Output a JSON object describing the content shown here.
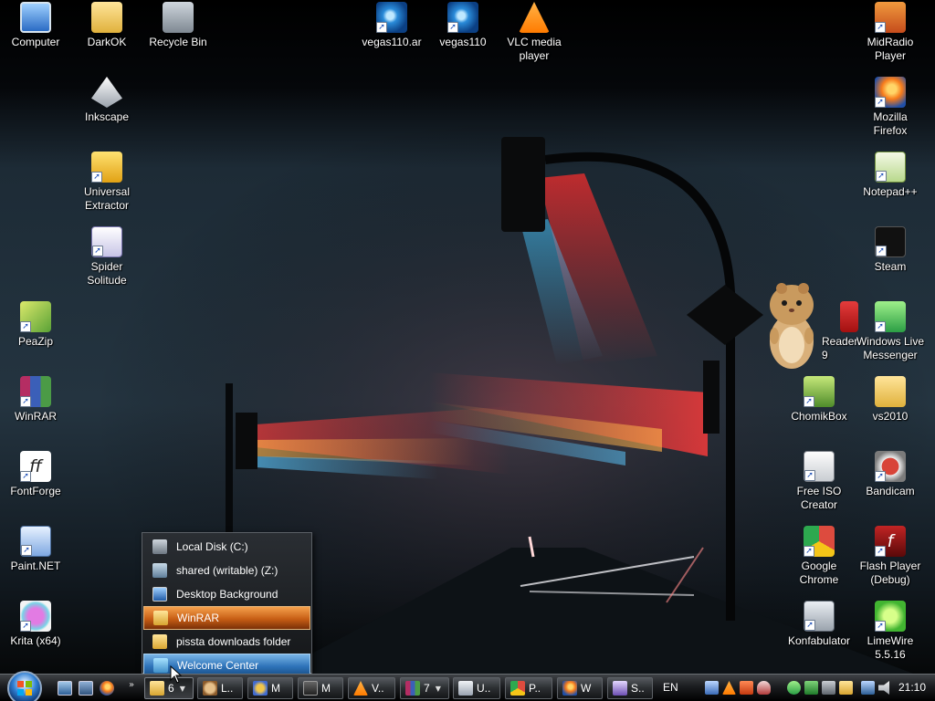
{
  "desktop": {
    "icons": [
      {
        "label": "Computer",
        "icon": "computer-icon"
      },
      {
        "label": "DarkOK",
        "icon": "folder-icon"
      },
      {
        "label": "Recycle Bin",
        "icon": "recycle-bin-icon"
      },
      {
        "label": "vegas110.ar",
        "icon": "vegas-icon"
      },
      {
        "label": "vegas110",
        "icon": "vegas-icon"
      },
      {
        "label": "VLC media\nplayer",
        "icon": "vlc-icon"
      },
      {
        "label": "MidRadio\nPlayer",
        "icon": "midradio-icon"
      },
      {
        "label": "Inkscape",
        "icon": "inkscape-icon"
      },
      {
        "label": "Mozilla\nFirefox",
        "icon": "firefox-icon"
      },
      {
        "label": "Universal\nExtractor",
        "icon": "extractor-icon"
      },
      {
        "label": "Notepad++",
        "icon": "notepadpp-icon"
      },
      {
        "label": "Spider\nSolitude",
        "icon": "spider-solitaire-icon"
      },
      {
        "label": "Steam",
        "icon": "steam-icon"
      },
      {
        "label": "PeaZip",
        "icon": "peazip-icon"
      },
      {
        "label": "Reader\n9",
        "icon": "adobe-reader-icon"
      },
      {
        "label": "Windows Live\nMessenger",
        "icon": "messenger-icon"
      },
      {
        "label": "WinRAR",
        "icon": "winrar-icon"
      },
      {
        "label": "ChomikBox",
        "icon": "chomikbox-icon"
      },
      {
        "label": "vs2010",
        "icon": "folder-icon"
      },
      {
        "label": "FontForge",
        "icon": "fontforge-icon"
      },
      {
        "label": "Free ISO\nCreator",
        "icon": "iso-creator-icon"
      },
      {
        "label": "Bandicam",
        "icon": "bandicam-icon"
      },
      {
        "label": "Paint.NET",
        "icon": "paintnet-icon"
      },
      {
        "label": "Google\nChrome",
        "icon": "chrome-icon"
      },
      {
        "label": "Flash Player\n(Debug)",
        "icon": "flash-icon"
      },
      {
        "label": "Krita (x64)",
        "icon": "krita-icon"
      },
      {
        "label": "Konfabulator",
        "icon": "konfabulator-icon"
      },
      {
        "label": "LimeWire\n5.5.16",
        "icon": "limewire-icon"
      }
    ]
  },
  "jumplist": {
    "items": [
      {
        "label": "Local Disk (C:)",
        "icon": "drive-icon"
      },
      {
        "label": "shared (writable) (Z:)",
        "icon": "network-drive-icon"
      },
      {
        "label": "Desktop Background",
        "icon": "desktop-background-icon"
      },
      {
        "label": "WinRAR",
        "icon": "folder-icon"
      },
      {
        "label": "pissta downloads folder",
        "icon": "folder-icon"
      },
      {
        "label": "Welcome Center",
        "icon": "welcome-center-icon"
      }
    ]
  },
  "taskbar": {
    "quick_launch_more": "»",
    "buttons": [
      {
        "label": "6",
        "icon": "folder-icon"
      },
      {
        "label": "L..",
        "icon": "hamster-icon"
      },
      {
        "label": "M",
        "icon": "media-icon"
      },
      {
        "label": "M",
        "icon": "mixer-icon"
      },
      {
        "label": "V..",
        "icon": "vlc-icon"
      },
      {
        "label": "7",
        "icon": "winrar-icon"
      },
      {
        "label": "U..",
        "icon": "document-icon"
      },
      {
        "label": "P..",
        "icon": "chrome-icon"
      },
      {
        "label": "W",
        "icon": "firefox-icon"
      },
      {
        "label": "S..",
        "icon": "spider-icon"
      }
    ],
    "language": "EN",
    "clock": "21:10"
  }
}
